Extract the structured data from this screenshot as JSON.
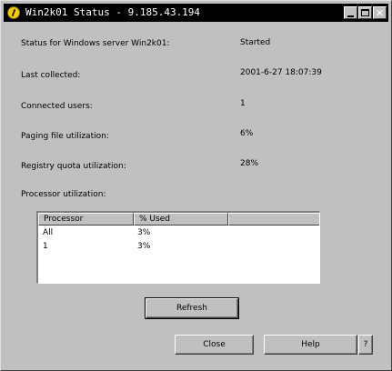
{
  "window": {
    "title": "Win2k01 Status - 9.185.43.194",
    "icon": "info-icon"
  },
  "status": {
    "server_label": "Status for Windows server Win2k01:",
    "server_value": "Started",
    "last_collected_label": "Last collected:",
    "last_collected_value": "2001-6-27 18:07:39",
    "connected_users_label": "Connected users:",
    "connected_users_value": "1",
    "paging_label": "Paging file utilization:",
    "paging_value": "6%",
    "registry_label": "Registry quota utilization:",
    "registry_value": "28%",
    "processor_label": "Processor utilization:"
  },
  "processor_table": {
    "columns": [
      "Processor",
      "% Used",
      ""
    ],
    "rows": [
      {
        "processor": "All",
        "used": "3%"
      },
      {
        "processor": "1",
        "used": "3%"
      }
    ]
  },
  "buttons": {
    "refresh": "Refresh",
    "close": "Close",
    "help": "Help",
    "question": "?"
  },
  "titlebar_buttons": {
    "close_glyph": "✕"
  }
}
